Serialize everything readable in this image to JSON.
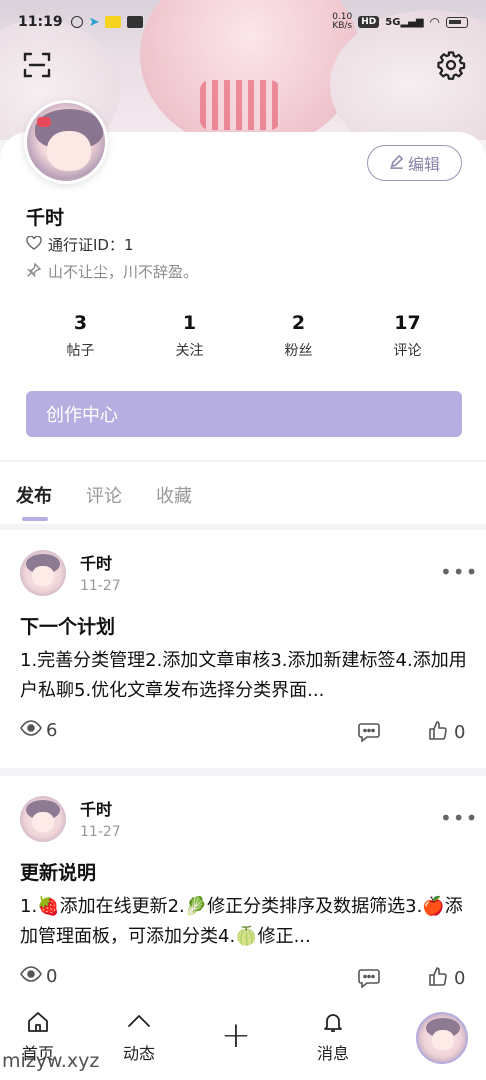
{
  "status_bar": {
    "time": "11:19",
    "net_speed": "0.10\nKB/s",
    "hd": "HD",
    "signal": "5G"
  },
  "profile": {
    "edit_label": "编辑",
    "username": "千时",
    "pass_label": "通行证ID：1",
    "signature": "山不让尘，川不辞盈。"
  },
  "stats": [
    {
      "value": "3",
      "label": "帖子"
    },
    {
      "value": "1",
      "label": "关注"
    },
    {
      "value": "2",
      "label": "粉丝"
    },
    {
      "value": "17",
      "label": "评论"
    }
  ],
  "create_center_label": "创作中心",
  "tabs": [
    {
      "label": "发布",
      "active": true
    },
    {
      "label": "评论",
      "active": false
    },
    {
      "label": "收藏",
      "active": false
    }
  ],
  "posts": [
    {
      "author": "千时",
      "date": "11-27",
      "title": "下一个计划",
      "body": "1.完善分类管理2.添加文章审核3.添加新建标签4.添加用户私聊5.优化文章发布选择分类界面...",
      "views": "6",
      "likes": "0"
    },
    {
      "author": "千时",
      "date": "11-27",
      "title": "更新说明",
      "body": "1.🍓添加在线更新2.🥬修正分类排序及数据筛选3.🍎添加管理面板，可添加分类4.🍈修正...",
      "views": "0",
      "likes": "0"
    }
  ],
  "more_glyph": "•••",
  "bottom_nav": {
    "home": "首页",
    "feed": "动态",
    "add": "+",
    "messages": "消息"
  },
  "watermark": "mizyw.xyz",
  "colors": {
    "accent": "#b6aee0",
    "edit_border": "#9d96b5"
  }
}
